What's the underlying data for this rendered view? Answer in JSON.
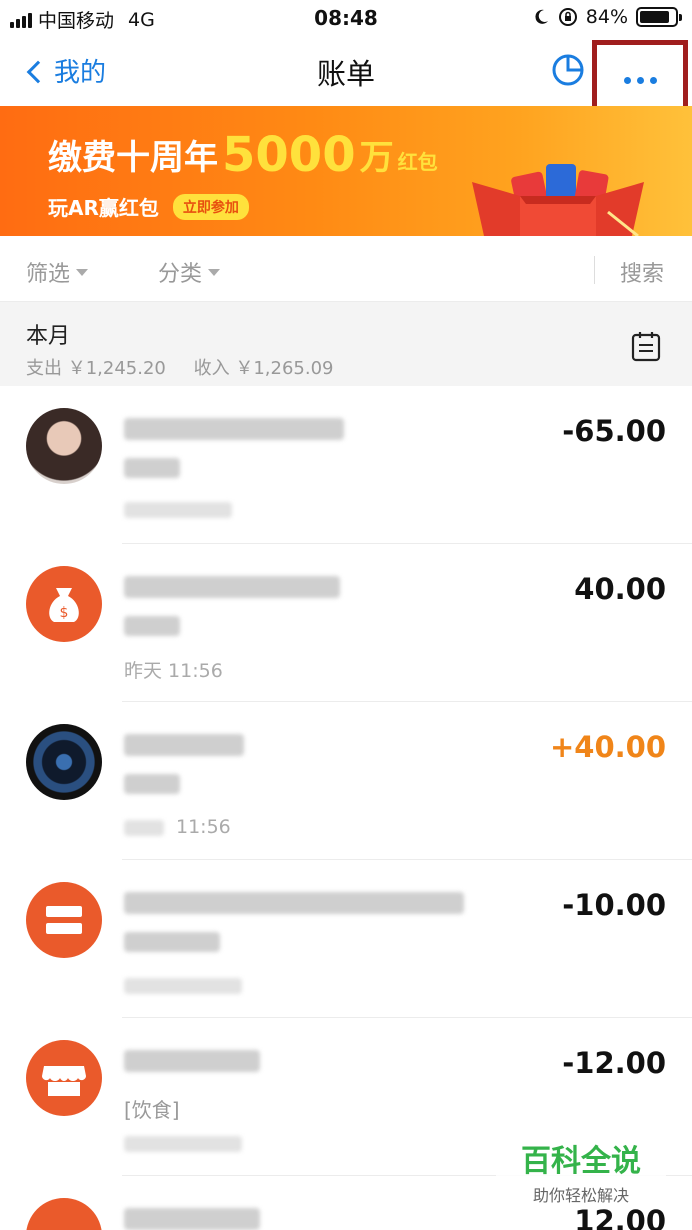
{
  "status_bar": {
    "carrier": "中国移动",
    "network": "4G",
    "time": "08:48",
    "battery": "84%",
    "battery_level": 0.84
  },
  "nav": {
    "back_label": "我的",
    "title": "账单"
  },
  "banner": {
    "title_part1": "缴费十周年",
    "title_amount": "5000",
    "title_unit": "万",
    "title_suffix": "红包",
    "subtitle": "玩AR赢红包",
    "join_label": "立即参加"
  },
  "filters": {
    "filter_label": "筛选",
    "category_label": "分类",
    "search_label": "搜索"
  },
  "month": {
    "label": "本月",
    "expense": "支出 ￥1,245.20",
    "income": "收入 ￥1,265.09"
  },
  "transactions": [
    {
      "amount": "-65.00",
      "time": ""
    },
    {
      "amount": "40.00",
      "time": "昨天 11:56"
    },
    {
      "amount": "+40.00",
      "time": "11:56"
    },
    {
      "amount": "-10.00",
      "time": ""
    },
    {
      "amount": "-12.00",
      "time": "",
      "category": "[饮食]"
    },
    {
      "amount": "12.00",
      "time": ""
    }
  ],
  "watermark": {
    "title": "百科全说",
    "subtitle": "助你轻松解决"
  },
  "colors": {
    "accent_blue": "#1a7de0",
    "income_orange": "#f08519",
    "highlight_red": "#a01e1e",
    "avatar_orange": "#ea5a2b"
  }
}
